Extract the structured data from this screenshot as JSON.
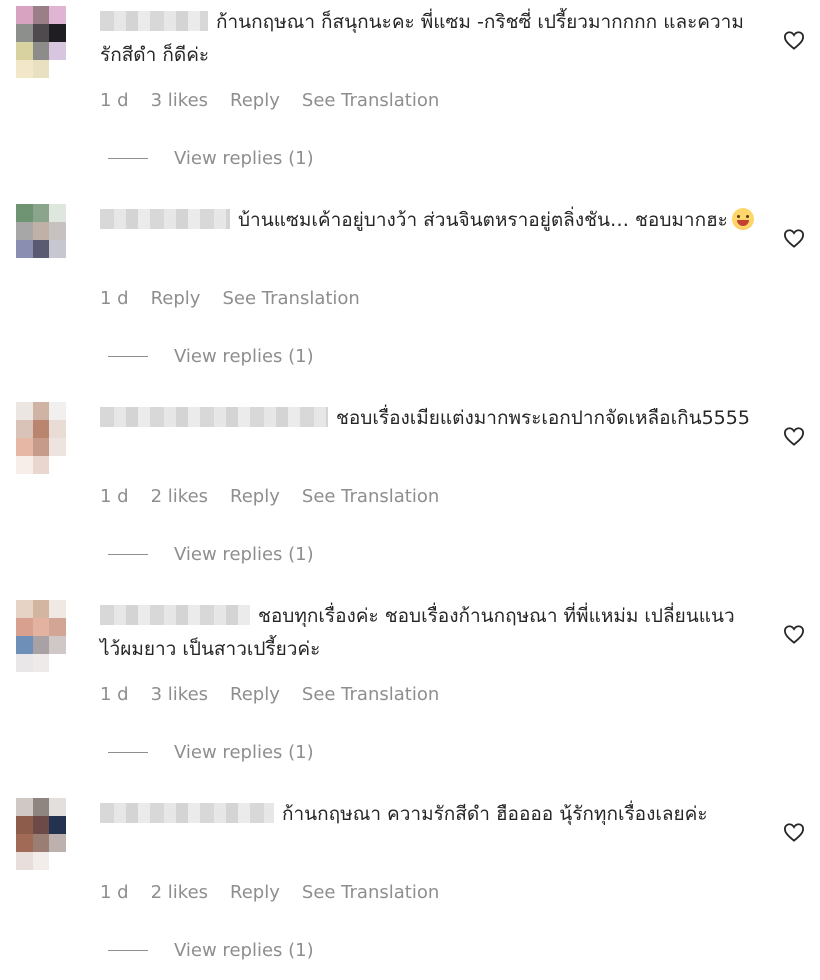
{
  "comments": [
    {
      "text": "ก้านกฤษณา ก็สนุกนะคะ พี่แซม -กริชซี่ เปรี้ยวมากกกก และความรักสีดำ ก็ดีค่ะ",
      "time": "1 d",
      "likes": "3 likes",
      "reply": "Reply",
      "translate": "See Translation",
      "view_replies": "View replies (1)"
    },
    {
      "text": "บ้านแซมเค้าอยู่บางว้า ส่วนจินตหราอยู่ตลิ่งชัน… ชอบมากฮะ",
      "time": "1 d",
      "likes": "",
      "reply": "Reply",
      "translate": "See Translation",
      "view_replies": "View replies (1)"
    },
    {
      "text": "ชอบเรื่องเมียแต่งมากพระเอกปากจัดเหลือเกิน5555",
      "time": "1 d",
      "likes": "2 likes",
      "reply": "Reply",
      "translate": "See Translation",
      "view_replies": "View replies (1)"
    },
    {
      "text": "ชอบทุกเรื่องค่ะ ชอบเรื่องก้านกฤษณา ที่พี่แหม่ม เปลี่ยนแนว ไว้ผมยาว เป็นสาวเปรี้ยวค่ะ",
      "time": "1 d",
      "likes": "3 likes",
      "reply": "Reply",
      "translate": "See Translation",
      "view_replies": "View replies (1)"
    },
    {
      "text": "ก้านกฤษณา ความรักสีดำ ฮืออออ นุ้รักทุกเรื่องเลยค่ะ",
      "time": "1 d",
      "likes": "2 likes",
      "reply": "Reply",
      "translate": "See Translation",
      "view_replies": "View replies (1)"
    }
  ],
  "icons": {
    "like": "heart-outline-icon",
    "emoji": "grinning-face-emoji"
  },
  "colors": {
    "text": "#262626",
    "secondary": "#8e8e8e",
    "background": "#ffffff"
  }
}
